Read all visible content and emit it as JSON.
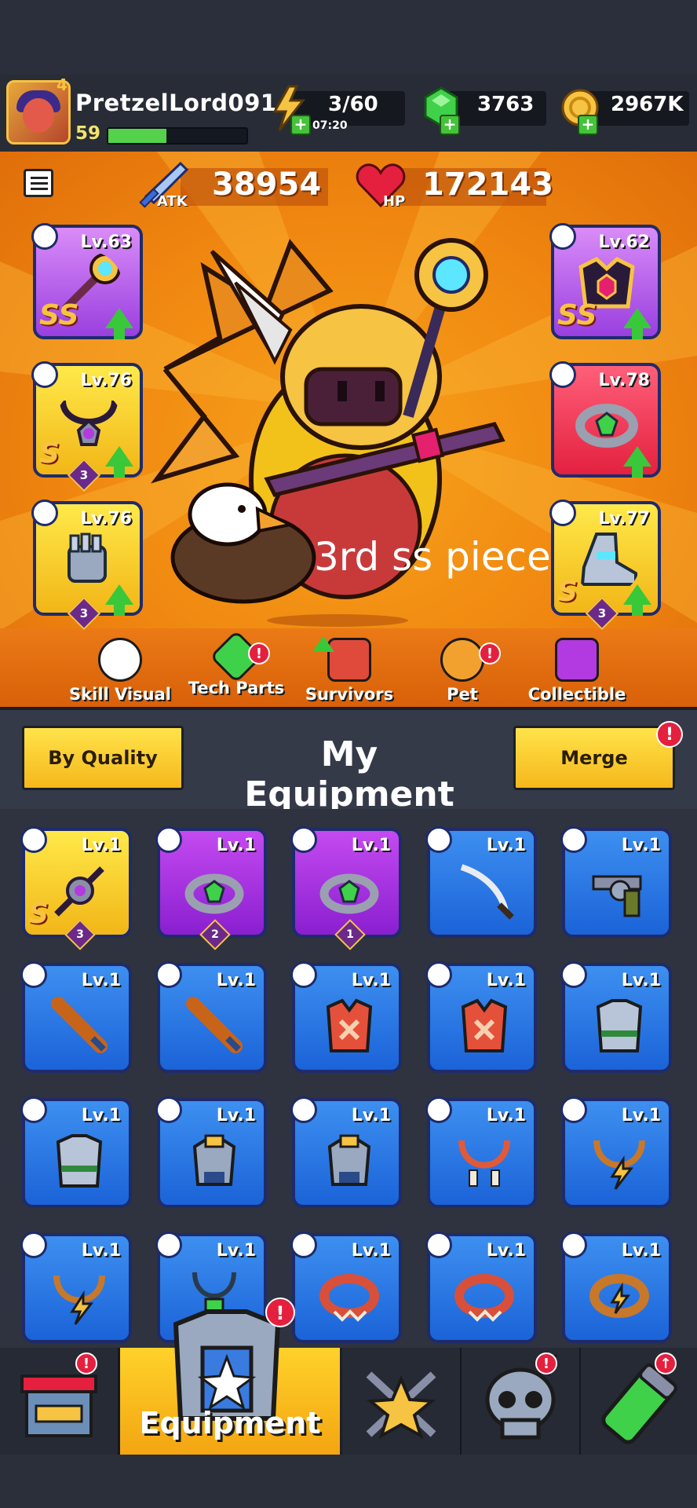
{
  "player": {
    "name": "PretzelLord091",
    "level": "59",
    "avatar_badge": "4",
    "xp_fraction": 0.42
  },
  "resources": {
    "energy": "3/60",
    "energy_timer": "07:20",
    "gems": "3763",
    "gold": "2967K"
  },
  "stats": {
    "atk_label": "ATK",
    "atk_value": "38954",
    "hp_label": "HP",
    "hp_value": "172143"
  },
  "equipped": {
    "weapon": {
      "level": "Lv.63",
      "grade": "SS"
    },
    "armor": {
      "level": "Lv.62",
      "grade": "SS"
    },
    "necklace": {
      "level": "Lv.76",
      "grade": "S",
      "stars": "3"
    },
    "ring": {
      "level": "Lv.78",
      "grade": ""
    },
    "gloves": {
      "level": "Lv.76",
      "grade": "",
      "stars": "3"
    },
    "boots": {
      "level": "Lv.77",
      "grade": "S",
      "stars": "3"
    }
  },
  "overlay_caption": "3rd ss piece",
  "tabs": {
    "skill_visual": "Skill Visual",
    "tech_parts": "Tech Parts",
    "survivors": "Survivors",
    "pet": "Pet",
    "collectible": "Collectible"
  },
  "equipment_panel": {
    "sort_button": "By Quality",
    "title": "My Equipment",
    "merge_button": "Merge"
  },
  "inventory": [
    {
      "level": "Lv.1",
      "grade": "S",
      "stars": "3",
      "rarity": "yellow",
      "icon": "spiked-staff-icon"
    },
    {
      "level": "Lv.1",
      "grade": "",
      "stars": "2",
      "rarity": "purple",
      "icon": "gem-ring-icon"
    },
    {
      "level": "Lv.1",
      "grade": "",
      "stars": "1",
      "rarity": "purple",
      "icon": "gem-ring-icon"
    },
    {
      "level": "Lv.1",
      "grade": "",
      "stars": "",
      "rarity": "blue",
      "icon": "katana-icon"
    },
    {
      "level": "Lv.1",
      "grade": "",
      "stars": "",
      "rarity": "blue",
      "icon": "revolver-icon"
    },
    {
      "level": "Lv.1",
      "grade": "",
      "stars": "",
      "rarity": "blue",
      "icon": "baseball-bat-icon"
    },
    {
      "level": "Lv.1",
      "grade": "",
      "stars": "",
      "rarity": "blue",
      "icon": "baseball-bat-icon"
    },
    {
      "level": "Lv.1",
      "grade": "",
      "stars": "",
      "rarity": "blue",
      "icon": "red-vest-icon"
    },
    {
      "level": "Lv.1",
      "grade": "",
      "stars": "",
      "rarity": "blue",
      "icon": "red-vest-icon"
    },
    {
      "level": "Lv.1",
      "grade": "",
      "stars": "",
      "rarity": "blue",
      "icon": "steel-armor-icon"
    },
    {
      "level": "Lv.1",
      "grade": "",
      "stars": "",
      "rarity": "blue",
      "icon": "steel-armor-icon"
    },
    {
      "level": "Lv.1",
      "grade": "",
      "stars": "",
      "rarity": "blue",
      "icon": "power-armor-icon"
    },
    {
      "level": "Lv.1",
      "grade": "",
      "stars": "",
      "rarity": "blue",
      "icon": "power-armor-icon"
    },
    {
      "level": "Lv.1",
      "grade": "",
      "stars": "",
      "rarity": "blue",
      "icon": "bone-necklace-icon"
    },
    {
      "level": "Lv.1",
      "grade": "",
      "stars": "",
      "rarity": "blue",
      "icon": "lightning-necklace-icon"
    },
    {
      "level": "Lv.1",
      "grade": "",
      "stars": "",
      "rarity": "blue",
      "icon": "lightning-necklace-icon"
    },
    {
      "level": "Lv.1",
      "grade": "",
      "stars": "",
      "rarity": "blue",
      "icon": "pendant-icon"
    },
    {
      "level": "Lv.1",
      "grade": "",
      "stars": "",
      "rarity": "blue",
      "icon": "red-belt-icon"
    },
    {
      "level": "Lv.1",
      "grade": "",
      "stars": "",
      "rarity": "blue",
      "icon": "red-belt-icon"
    },
    {
      "level": "Lv.1",
      "grade": "",
      "stars": "",
      "rarity": "blue",
      "icon": "lightning-belt-icon"
    }
  ],
  "bottom_nav": {
    "shop": "",
    "equipment": "Equipment",
    "challenge": "",
    "skull": "",
    "evolve": ""
  },
  "colors": {
    "accent_orange": "#f08710",
    "button_yellow": "#f5b81b",
    "rarity_blue": "#1b63d8",
    "rarity_purple": "#8a1fd0",
    "rarity_yellow": "#f2b617",
    "notification_red": "#e5203f"
  }
}
